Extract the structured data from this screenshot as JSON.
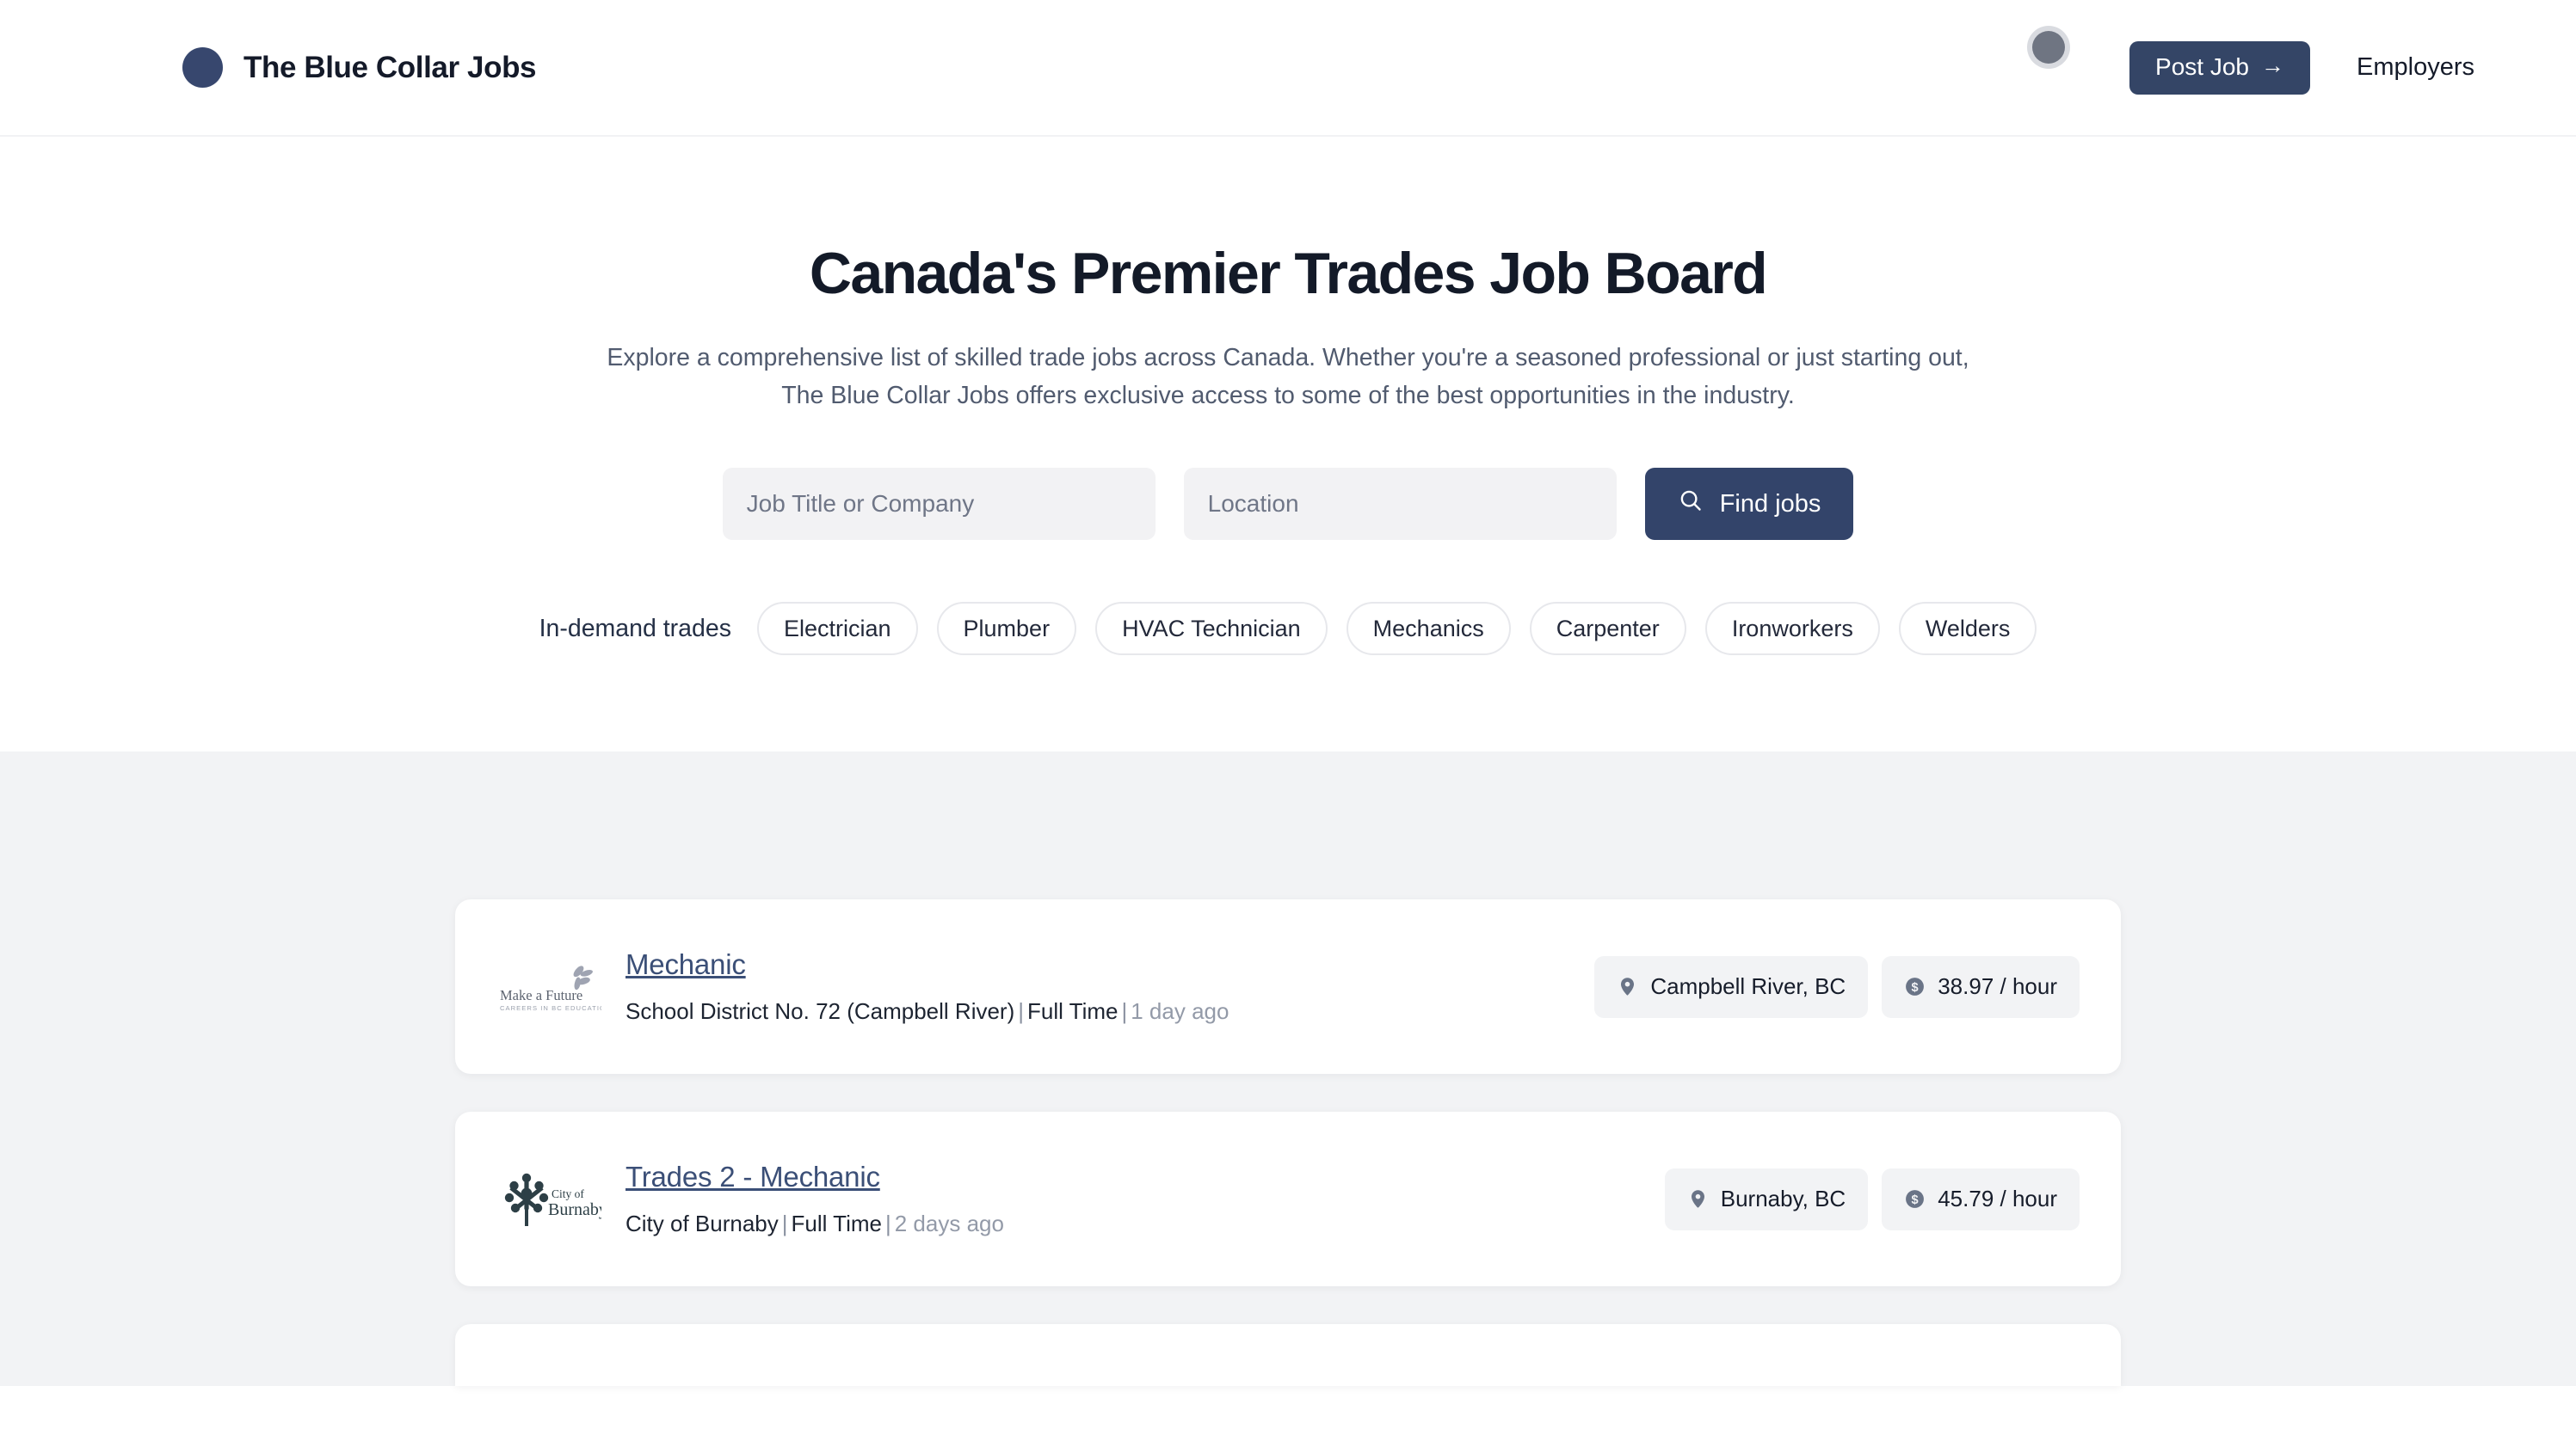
{
  "header": {
    "brand_name": "The Blue Collar Jobs",
    "brand_mark_color": "#37476e",
    "post_job_label": "Post Job",
    "post_job_arrow": "→",
    "employers_label": "Employers"
  },
  "hero": {
    "title": "Canada's Premier Trades Job Board",
    "subtitle": "Explore a comprehensive list of skilled trade jobs across Canada. Whether you're a seasoned professional or just starting out, The Blue Collar Jobs offers exclusive access to some of the best opportunities in the industry."
  },
  "search": {
    "job_title_value": "",
    "job_title_placeholder": "Job Title or Company",
    "location_value": "",
    "location_placeholder": "Location",
    "find_jobs_label": "Find jobs",
    "button_color": "#33446a"
  },
  "trades": {
    "label": "In-demand trades",
    "chips": [
      {
        "label": "Electrician"
      },
      {
        "label": "Plumber"
      },
      {
        "label": "HVAC Technician"
      },
      {
        "label": "Mechanics"
      },
      {
        "label": "Carpenter"
      },
      {
        "label": "Ironworkers"
      },
      {
        "label": "Welders"
      }
    ]
  },
  "jobs": {
    "section_bg": "#f2f3f5",
    "items": [
      {
        "title": "Mechanic",
        "company": "School District No. 72 (Campbell River)",
        "employment_type": "Full Time",
        "posted": "1 day ago",
        "location": "Campbell River, BC",
        "pay": "38.97 / hour",
        "logo": "make-a-future-logo",
        "logo_text_primary": "Make a Future",
        "logo_text_secondary": "CAREERS IN BC EDUCATION"
      },
      {
        "title": "Trades 2 - Mechanic",
        "company": "City of Burnaby",
        "employment_type": "Full Time",
        "posted": "2 days ago",
        "location": "Burnaby, BC",
        "pay": "45.79 / hour",
        "logo": "city-of-burnaby-logo",
        "logo_text_primary": "City of",
        "logo_text_secondary": "Burnaby"
      }
    ]
  },
  "colors": {
    "navy": "#344566",
    "title_link": "#3b4f77",
    "muted": "#939aa8",
    "page_bg": "#ffffff",
    "section_bg": "#f2f3f5",
    "field_bg": "#f2f2f4"
  }
}
